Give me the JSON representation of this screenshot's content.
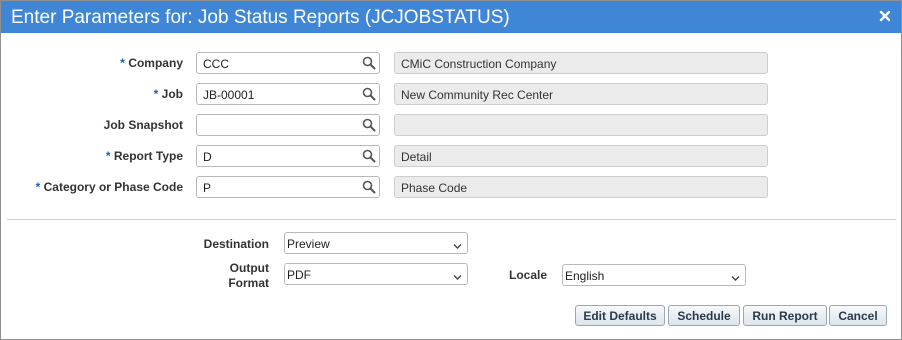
{
  "dialog": {
    "title": "Enter Parameters for: Job Status Reports (JCJOBSTATUS)",
    "close_icon": "close-icon"
  },
  "params": [
    {
      "required": true,
      "label": "Company",
      "value": "CCC",
      "description": "CMiC Construction Company"
    },
    {
      "required": true,
      "label": "Job",
      "value": "JB-00001",
      "description": "New Community Rec Center"
    },
    {
      "required": false,
      "label": "Job Snapshot",
      "value": "",
      "description": ""
    },
    {
      "required": true,
      "label": "Report Type",
      "value": "D",
      "description": "Detail"
    },
    {
      "required": true,
      "label": "Category or Phase Code",
      "value": "P",
      "description": "Phase Code"
    }
  ],
  "required_marker": "*",
  "output": {
    "destination_label": "Destination",
    "destination_value": "Preview",
    "format_label_line1": "Output",
    "format_label_line2": "Format",
    "format_value": "PDF",
    "locale_label": "Locale",
    "locale_value": "English"
  },
  "buttons": {
    "edit_defaults": "Edit Defaults",
    "schedule": "Schedule",
    "run_report": "Run Report",
    "cancel": "Cancel"
  },
  "colors": {
    "titlebar": "#3f86d6",
    "required_marker": "#1a5fb4"
  }
}
